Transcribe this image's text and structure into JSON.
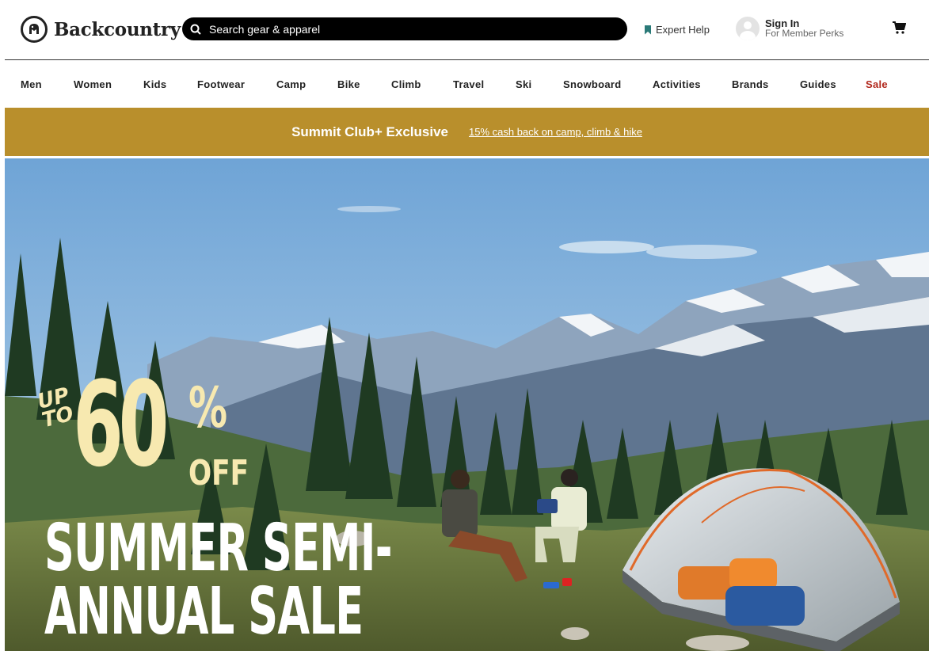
{
  "brand": {
    "name": "Backcountry"
  },
  "search": {
    "placeholder": "Search gear & apparel"
  },
  "header": {
    "expert_help": "Expert Help",
    "sign_in": "Sign In",
    "member_perks": "For Member Perks"
  },
  "nav": {
    "items": [
      {
        "label": "Men"
      },
      {
        "label": "Women"
      },
      {
        "label": "Kids"
      },
      {
        "label": "Footwear"
      },
      {
        "label": "Camp"
      },
      {
        "label": "Bike"
      },
      {
        "label": "Climb"
      },
      {
        "label": "Travel"
      },
      {
        "label": "Ski"
      },
      {
        "label": "Snowboard"
      },
      {
        "label": "Activities"
      },
      {
        "label": "Brands"
      },
      {
        "label": "Guides"
      },
      {
        "label": "Sale",
        "color": "#b1271b"
      }
    ]
  },
  "promo": {
    "title": "Summit Club+ Exclusive",
    "link": "15% cash back on camp, climb & hike",
    "background": "#b98f2c"
  },
  "hero": {
    "up_to": "UP TO",
    "percent": "60",
    "percent_sign": "%",
    "off": "OFF",
    "headline_1": "SUMMER SEMI-",
    "headline_2": "ANNUAL SALE",
    "accent": "#f7e9b0"
  },
  "icons": {
    "logo": "backcountry-goat-logo-icon",
    "search": "search-icon",
    "expert": "bookmark-icon",
    "account": "user-avatar-icon",
    "cart": "shopping-cart-icon"
  }
}
